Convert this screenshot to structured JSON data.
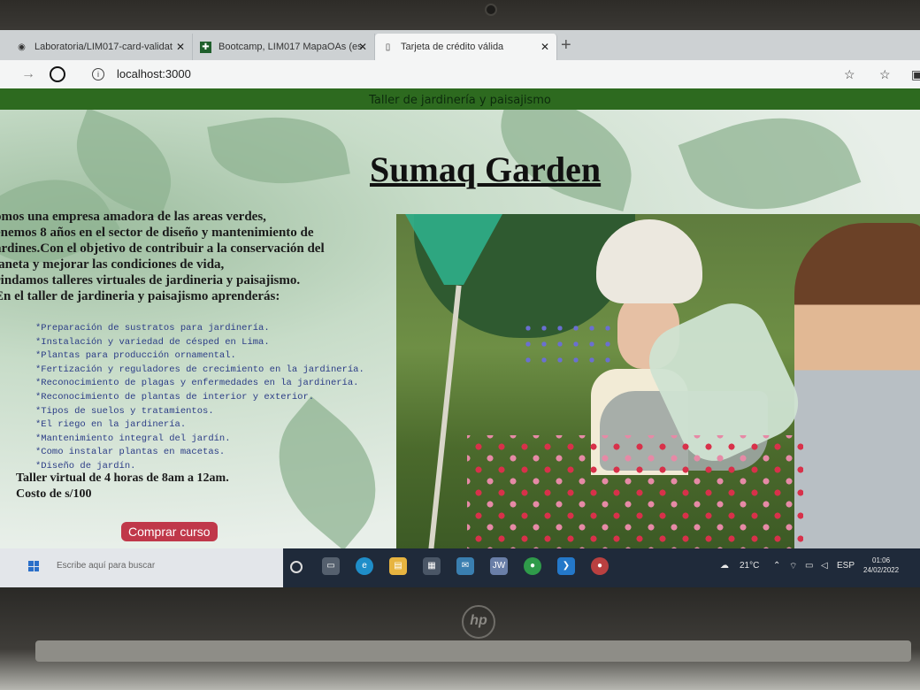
{
  "browser": {
    "tabs": [
      {
        "label": "Laboratoria/LIM017-card-validat",
        "icon": "github-icon",
        "active": false
      },
      {
        "label": "Bootcamp, LIM017 MapaOAs (es",
        "icon": "sheet-icon",
        "active": false
      },
      {
        "label": "Tarjeta de crédito válida",
        "icon": "page-icon",
        "active": true
      }
    ],
    "url": "localhost:3000"
  },
  "page": {
    "banner": "Taller de jardinería y paisajismo",
    "title": "Sumaq Garden",
    "intro_lines": [
      "omos una empresa amadora de las areas verdes,",
      "enemos 8 años en el sector de diseño y mantenimiento de",
      "ardines.Con el objetivo de contribuir a la conservación del",
      "laneta y mejorar las condiciones de vida,",
      "rindamos talleres virtuales de jardineria y paisajismo.",
      "En el taller de jardineria y paisajismo aprenderás:"
    ],
    "topics": [
      "*Preparación de sustratos para jardinería.",
      "*Instalación y variedad de césped en Lima.",
      "*Plantas para producción ornamental.",
      "*Fertización y reguladores de crecimiento en la jardinería.",
      "*Reconocimiento de plagas y enfermedades en la jardinería.",
      "*Reconocimiento de plantas de interior y exterior.",
      "*Tipos de suelos y tratamientos.",
      "*El riego en la jardinería.",
      "*Mantenimiento integral del jardín.",
      "*Como instalar plantas en macetas.",
      "*Diseño de jardín."
    ],
    "schedule": "Taller virtual de 4 horas de 8am a 12am.",
    "price": "Costo de s/100",
    "buy_button": "Comprar curso"
  },
  "taskbar": {
    "search_placeholder": "Escribe aquí para buscar",
    "weather": "21°C",
    "language": "ESP",
    "time": "01:06",
    "date": "24/02/2022"
  },
  "colors": {
    "banner_green": "#2d6a1f",
    "button_red": "#c0384a",
    "topic_blue": "#2b3c86"
  }
}
